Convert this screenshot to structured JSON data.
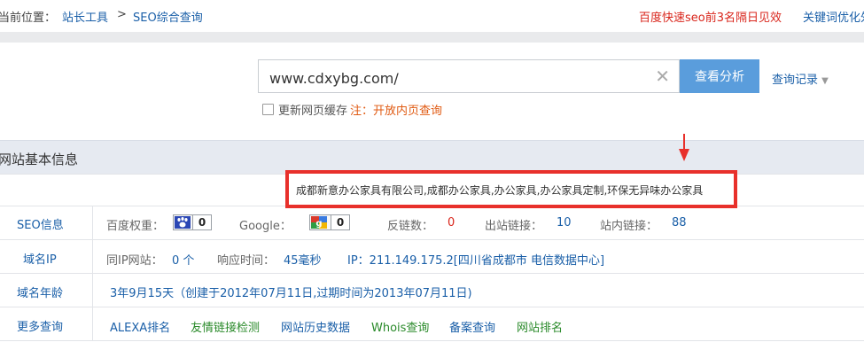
{
  "breadcrumb": {
    "prefix": "当前位置：",
    "item1": "站长工具",
    "sep": ">",
    "item2": "SEO综合查询"
  },
  "promo": {
    "red": "百度快速seo前3名隔日见效",
    "blue": "关键词优化外"
  },
  "search": {
    "value": "www.cdxybg.com/",
    "clear_glyph": "✕",
    "button": "查看分析",
    "history": "查询记录",
    "refresh_label": "更新网页缓存",
    "note": "注：开放内页查询"
  },
  "section": {
    "title": "网站基本信息"
  },
  "annotation": {
    "text": "成都新意办公家具有限公司,成都办公家具,办公家具,办公家具定制,环保无异味办公家具"
  },
  "seo": {
    "label": "SEO信息",
    "baidu_label": "百度权重：",
    "baidu_value": "0",
    "google_label": "Google：",
    "google_value": "0",
    "backlinks_label": "反链数：",
    "backlinks_value": "0",
    "outlinks_label": "出站链接：",
    "outlinks_value": "10",
    "inlinks_label": "站内链接：",
    "inlinks_value": "88"
  },
  "ip": {
    "label": "域名IP",
    "same_ip_label": "同IP网站：",
    "same_ip_value": "0 个",
    "response_label": "响应时间：",
    "response_value": "45毫秒",
    "ip_text": "IP：211.149.175.2[四川省成都市 电信数据中心]"
  },
  "age": {
    "label": "域名年龄",
    "text": "3年9月15天（创建于2012年07月11日,过期时间为2013年07月11日)"
  },
  "more": {
    "label": "更多查询",
    "links": [
      "ALEXA排名",
      "友情链接检测",
      "网站历史数据",
      "Whois查询",
      "备案查询",
      "网站排名"
    ]
  },
  "colors": {
    "accent": "#5a9ddc",
    "link": "#1a5fa8",
    "highlight": "#e8302b"
  }
}
